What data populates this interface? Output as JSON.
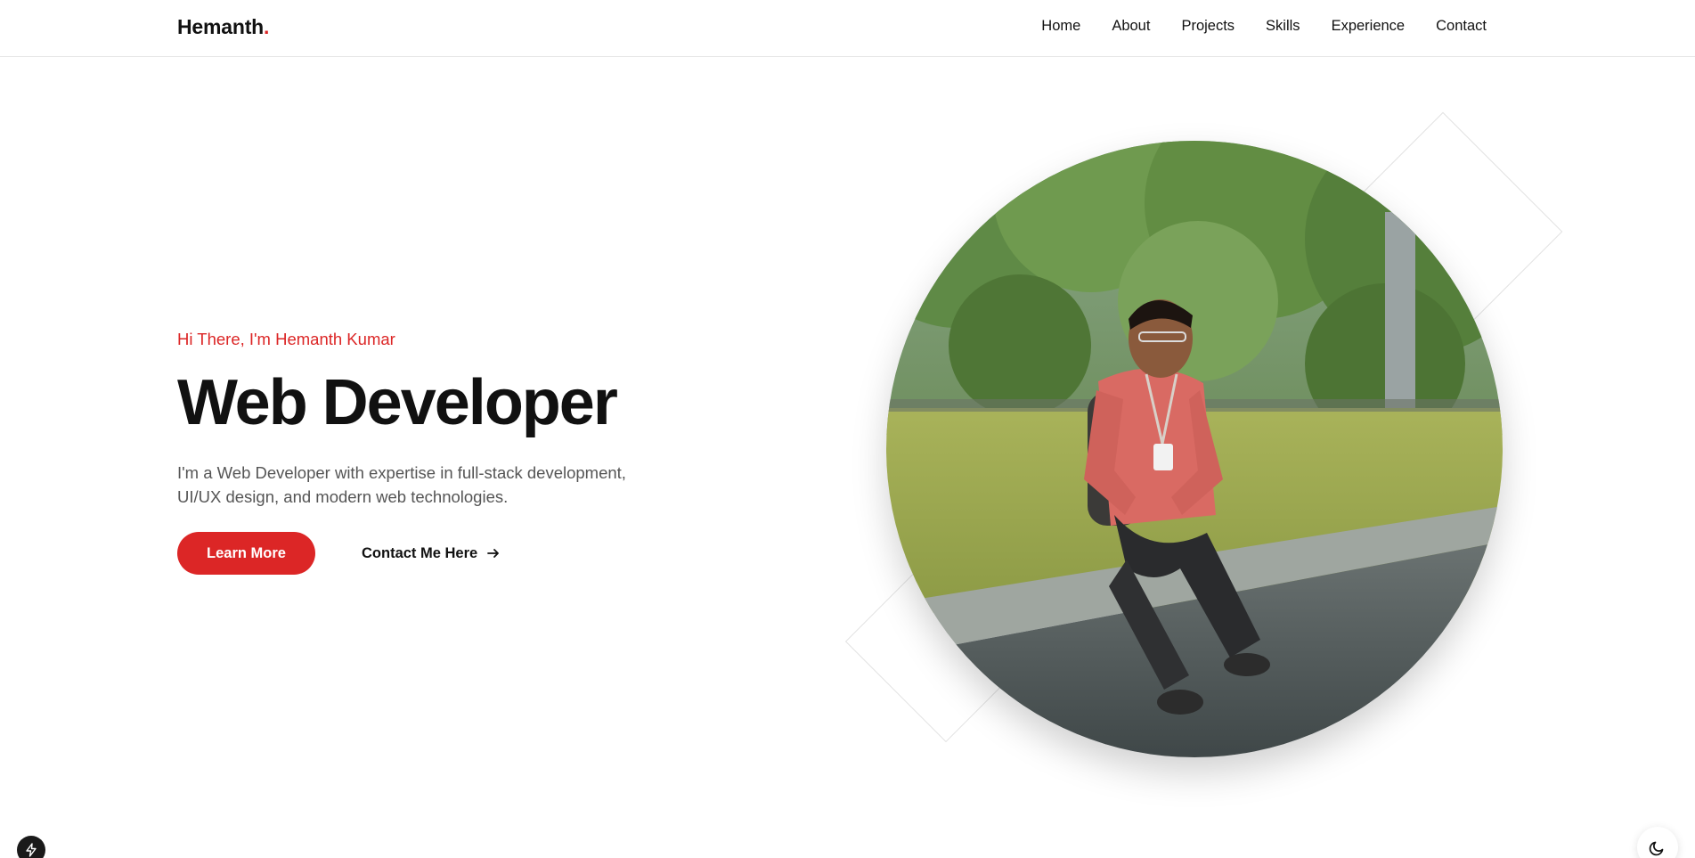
{
  "header": {
    "logo_text": "Hemanth",
    "logo_dot": ".",
    "nav": [
      "Home",
      "About",
      "Projects",
      "Skills",
      "Experience",
      "Contact"
    ]
  },
  "hero": {
    "greeting": "Hi There, I'm Hemanth Kumar",
    "headline": "Web Developer",
    "description_line1": "I'm a Web Developer with expertise in full-stack development,",
    "description_line2": "UI/UX design, and modern web technologies.",
    "primary_button": "Learn More",
    "secondary_link": "Contact Me Here",
    "photo_alt": "Hemanth Kumar sitting on a ledge in a park"
  },
  "floating": {
    "left_icon": "lightning-icon",
    "right_icon": "moon-icon"
  },
  "colors": {
    "accent": "#dc2626",
    "text": "#111111",
    "muted": "#555555"
  }
}
